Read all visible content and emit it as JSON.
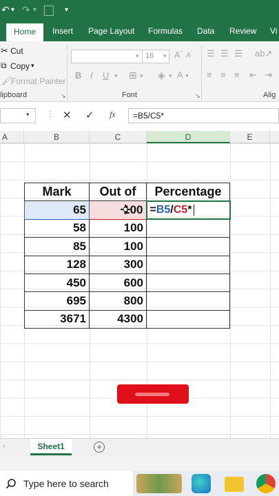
{
  "quick_access": {
    "undo_glyph": "↶",
    "dropdown_glyph": "▾",
    "redo_glyph": "↷",
    "customize_glyph": "▾"
  },
  "ribbon_tabs": [
    "Home",
    "Insert",
    "Page Layout",
    "Formulas",
    "Data",
    "Review",
    "Vi"
  ],
  "clipboard": {
    "cut": "Cut",
    "copy": "Copy",
    "format_painter": "Format Painter",
    "group_label": "lipboard"
  },
  "font": {
    "font_name": "",
    "font_size": "16",
    "group_label": "Font",
    "bold": "B",
    "italic": "I",
    "underline": "U"
  },
  "alignment": {
    "group_label": "Alig"
  },
  "formula_bar": {
    "name_box": "",
    "fx": "fx",
    "formula": "=B5/C5*"
  },
  "columns": [
    "A",
    "B",
    "C",
    "D",
    "E"
  ],
  "table": {
    "headers": [
      "Mark",
      "Out of",
      "Percentage"
    ],
    "rows": [
      [
        "65",
        "100",
        ""
      ],
      [
        "58",
        "100",
        ""
      ],
      [
        "85",
        "100",
        ""
      ],
      [
        "128",
        "300",
        ""
      ],
      [
        "450",
        "600",
        ""
      ],
      [
        "695",
        "800",
        ""
      ],
      [
        "3671",
        "4300",
        ""
      ]
    ],
    "editing_formula": {
      "prefix": "=",
      "ref_b": "B5",
      "slash": "/",
      "ref_c": "C5",
      "suffix": "*"
    }
  },
  "sheet": {
    "name": "Sheet1",
    "add": "+"
  },
  "taskbar": {
    "search_placeholder": "Type here to search"
  },
  "colors": {
    "excel_green": "#217346",
    "ref_blue": "#2f5da8",
    "ref_red": "#b8222a",
    "button_red": "#e0101a"
  }
}
